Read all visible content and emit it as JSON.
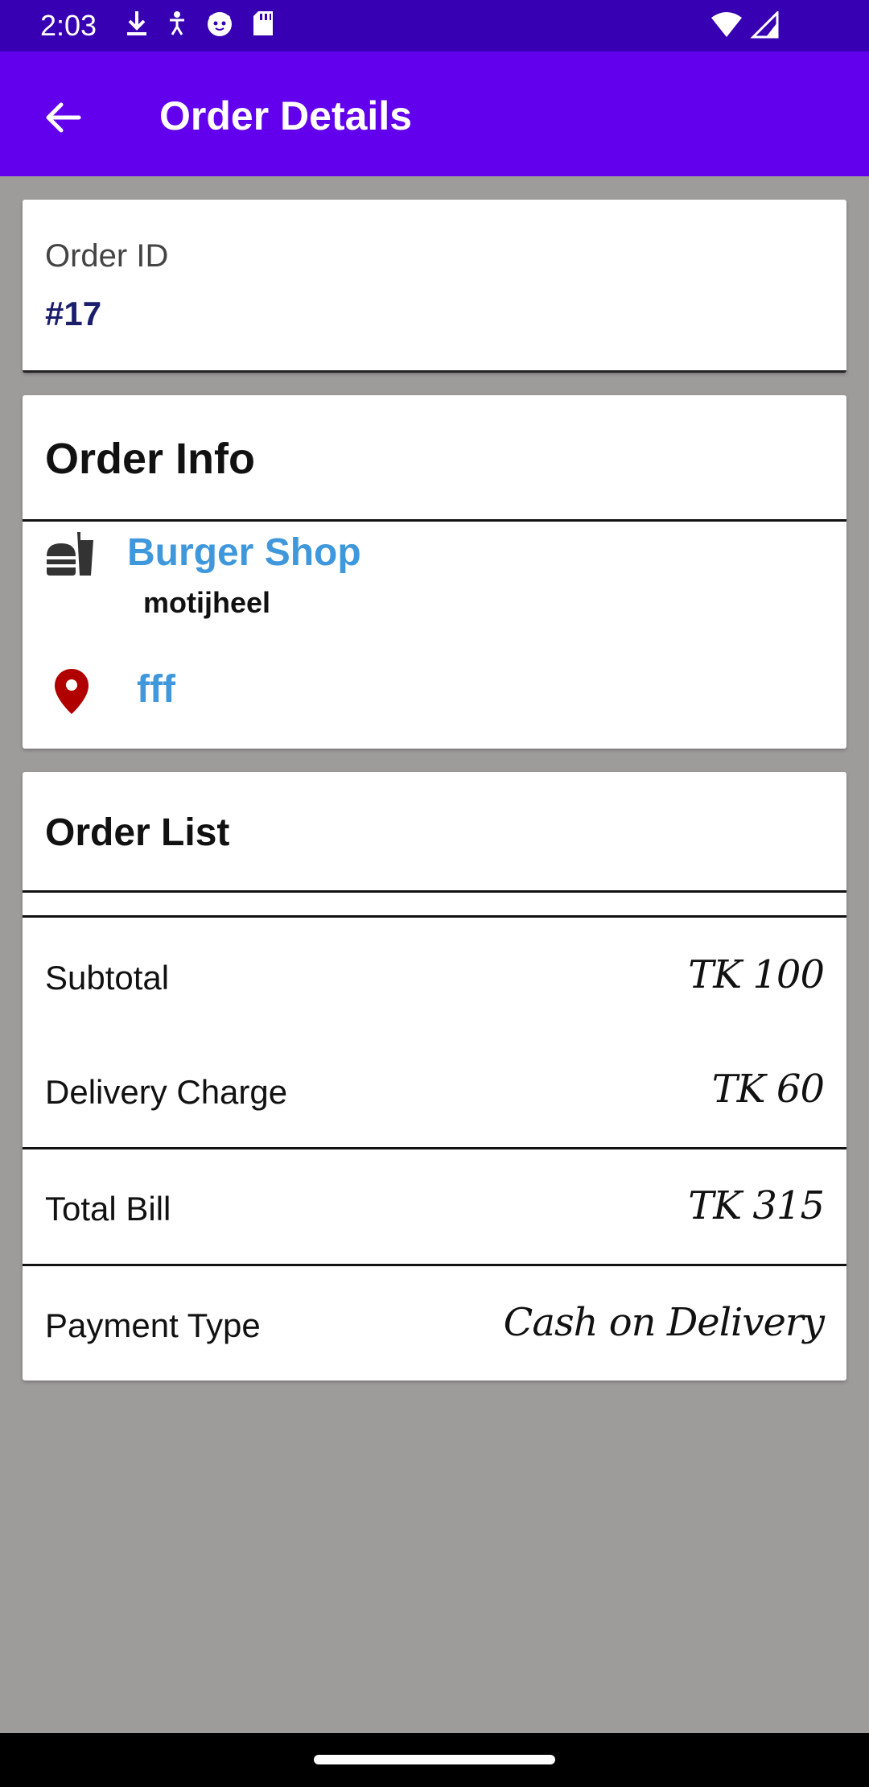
{
  "status_bar": {
    "time": "2:03",
    "left_icons": [
      "download-icon",
      "accessibility-icon",
      "cat-icon",
      "sd-card-icon"
    ],
    "right_icons": [
      "wifi-icon",
      "signal-icon"
    ]
  },
  "app_bar": {
    "title": "Order Details",
    "back_icon": "arrow-back-icon"
  },
  "order_id": {
    "label": "Order ID",
    "value": "#17"
  },
  "order_info": {
    "heading": "Order Info",
    "shop_name": "Burger Shop",
    "shop_area": "motijheel",
    "address": "fff"
  },
  "order_list": {
    "heading": "Order List",
    "rows": [
      {
        "label": "Subtotal",
        "value": "TK 100"
      },
      {
        "label": "Delivery Charge",
        "value": "TK 60"
      },
      {
        "label": "Total Bill",
        "value": "TK 315"
      },
      {
        "label": "Payment Type",
        "value": "Cash on Delivery"
      }
    ]
  },
  "colors": {
    "status_bar": "#3700b3",
    "app_bar": "#6200ee",
    "accent_text": "#4098dc",
    "order_id_text": "#1b1f6b",
    "pin": "#b00000",
    "background": "#9e9c9b"
  }
}
